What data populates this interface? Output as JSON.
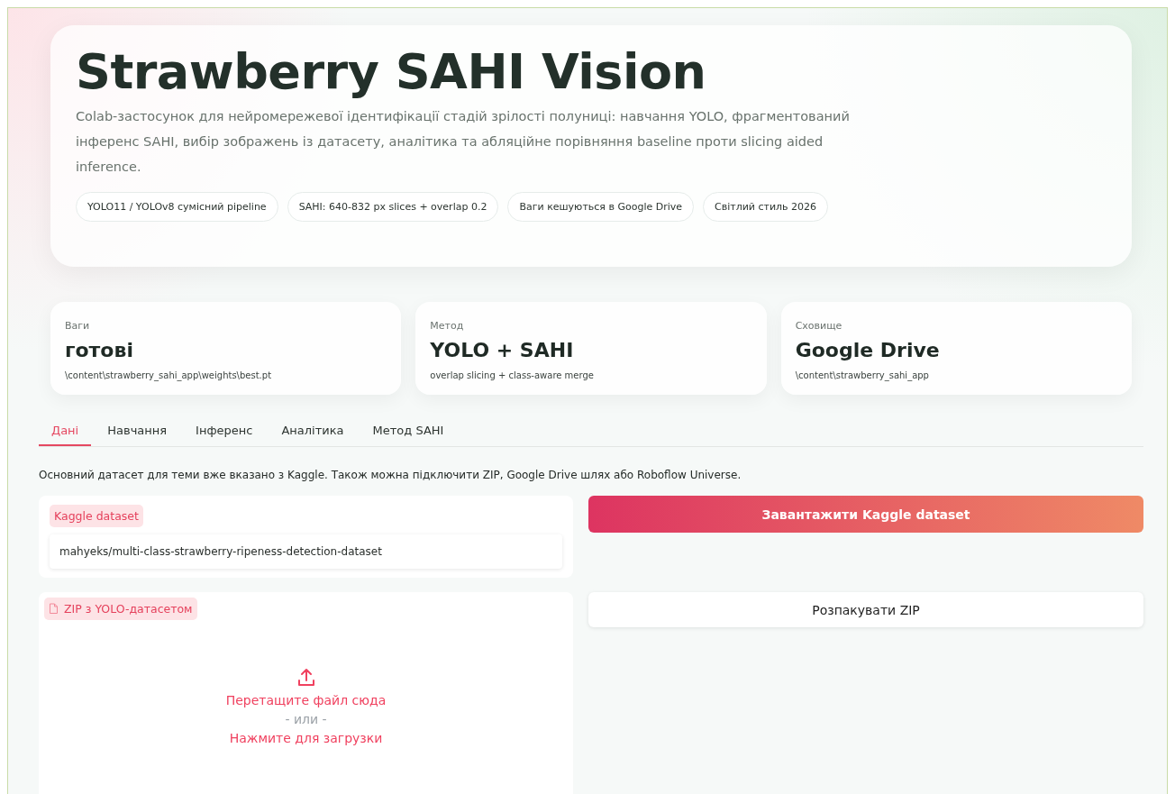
{
  "hero": {
    "title": "Strawberry SAHI Vision",
    "description": "Colab-застосунок для нейромережевої ідентифікації стадій зрілості полуниці: навчання YOLO, фрагментований інференс SAHI, вибір зображень із датасету, аналітика та абляційне порівняння baseline проти slicing aided inference.",
    "chips": [
      "YOLO11 / YOLOv8 сумісний pipeline",
      "SAHI: 640-832 px slices + overlap 0.2",
      "Ваги кешуються в Google Drive",
      "Світлий стиль 2026"
    ]
  },
  "stats": [
    {
      "label": "Ваги",
      "value": "готові",
      "detail": "\\content\\strawberry_sahi_app\\weights\\best.pt"
    },
    {
      "label": "Метод",
      "value": "YOLO + SAHI",
      "detail": "overlap slicing + class-aware merge"
    },
    {
      "label": "Сховище",
      "value": "Google Drive",
      "detail": "\\content\\strawberry_sahi_app"
    }
  ],
  "tabs": [
    {
      "label": "Дані",
      "selected": true
    },
    {
      "label": "Навчання",
      "selected": false
    },
    {
      "label": "Інференс",
      "selected": false
    },
    {
      "label": "Аналітика",
      "selected": false
    },
    {
      "label": "Метод SAHI",
      "selected": false
    }
  ],
  "intro": "Основний датасет для теми вже вказано з Kaggle. Також можна підключити ZIP, Google Drive шлях або Roboflow Universe.",
  "kaggle": {
    "label": "Kaggle dataset",
    "value": "mahyeks/multi-class-strawberry-ripeness-detection-dataset",
    "button": "Завантажити Kaggle dataset"
  },
  "zip": {
    "label": "ZIP з YOLO-датасетом",
    "drop_text": "Перетащите файл сюда",
    "or_text": "- или -",
    "click_text": "Нажмите для загрузки",
    "button": "Розпакувати ZIP"
  }
}
